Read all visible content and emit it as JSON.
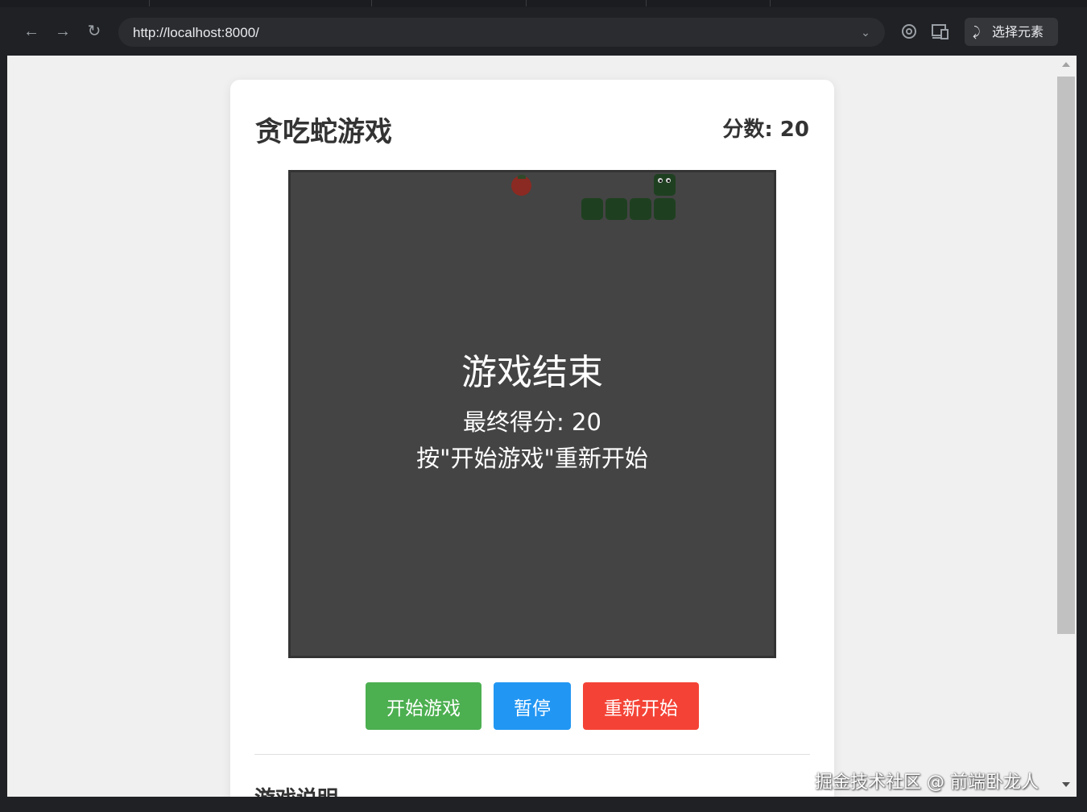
{
  "browser": {
    "url": "http://localhost:8000/",
    "back_icon": "arrow-left-icon",
    "forward_icon": "arrow-right-icon",
    "reload_icon": "reload-icon",
    "select_element_label": "选择元素"
  },
  "game": {
    "title": "贪吃蛇游戏",
    "score_label": "分数: 20",
    "overlay": {
      "title": "游戏结束",
      "final_score": "最终得分: 20",
      "hint": "按\"开始游戏\"重新开始"
    },
    "buttons": {
      "start": "开始游戏",
      "pause": "暂停",
      "restart": "重新开始"
    },
    "instructions_title": "游戏说明",
    "colors": {
      "board": "#444444",
      "snake": "#1e4020",
      "food": "#8b2a22",
      "start": "#4caf50",
      "pause": "#2196f3",
      "restart": "#f44336"
    }
  },
  "watermark": "掘金技术社区 @ 前端卧龙人"
}
